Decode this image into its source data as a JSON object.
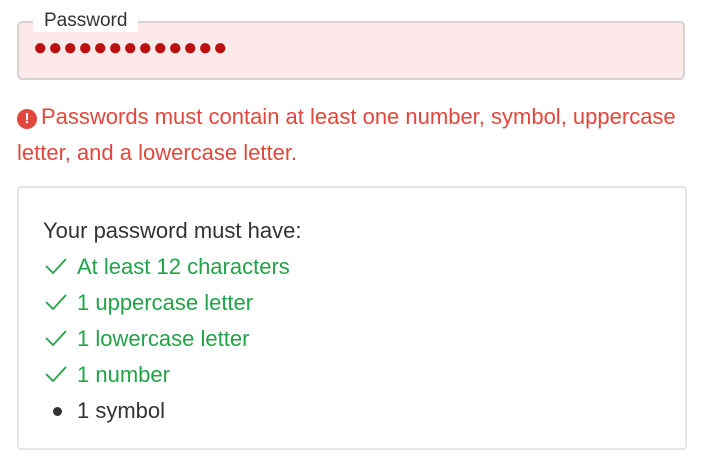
{
  "password_field": {
    "label": "Password",
    "value": "●●●●●●●●●●●●●"
  },
  "error": {
    "icon": "exclamation-circle-icon",
    "message": "Passwords must contain at least one number, symbol, uppercase letter, and a lowercase letter."
  },
  "requirements": {
    "title": "Your password must have:",
    "items": [
      {
        "label": "At least 12 characters",
        "met": true
      },
      {
        "label": "1 uppercase letter",
        "met": true
      },
      {
        "label": "1 lowercase letter",
        "met": true
      },
      {
        "label": "1 number",
        "met": true
      },
      {
        "label": "1 symbol",
        "met": false
      }
    ]
  },
  "colors": {
    "error_red": "#e2473d",
    "field_bg": "#fde9e9",
    "dot_red": "#bb1010",
    "met_green": "#22a34a",
    "text_dark": "#333333"
  }
}
